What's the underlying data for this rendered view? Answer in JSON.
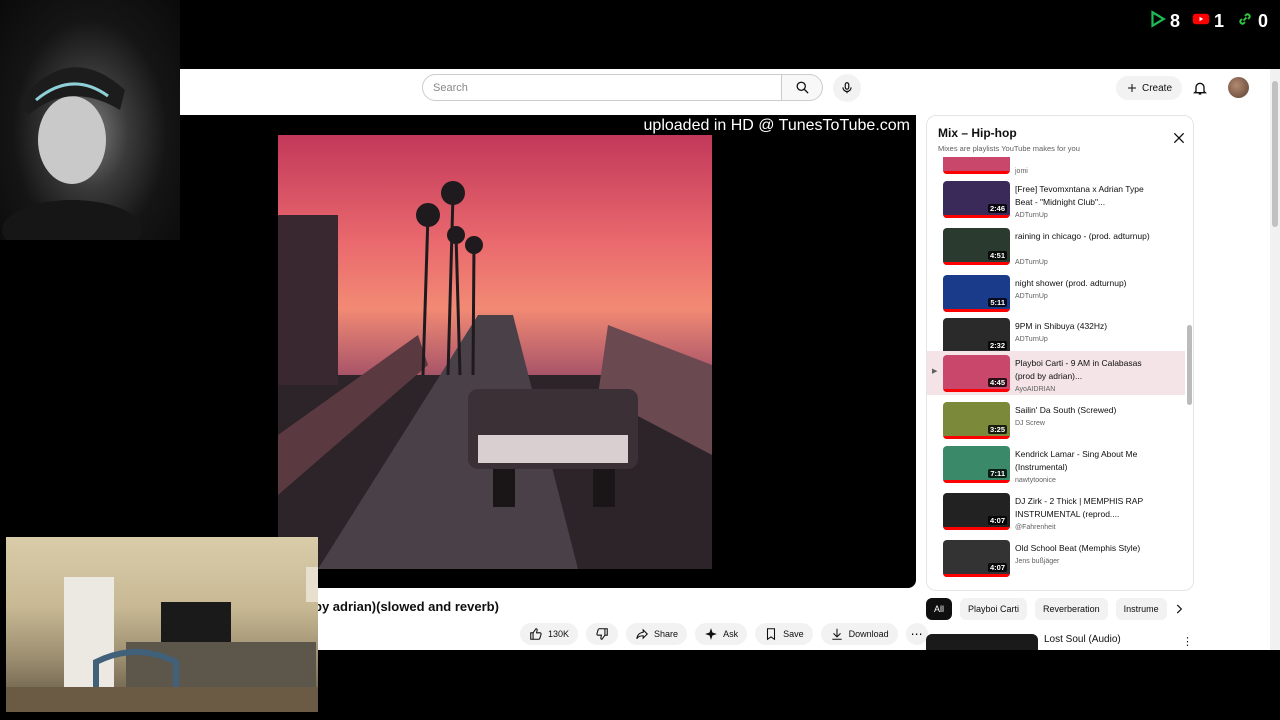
{
  "overlay": {
    "counters": [
      {
        "icon": "play-triangle-icon",
        "color": "#1db954",
        "value": "8"
      },
      {
        "icon": "youtube-icon",
        "color": "#ff0000",
        "value": "1"
      },
      {
        "icon": "link-icon",
        "color": "#2ecc40",
        "value": "0"
      }
    ]
  },
  "header": {
    "search_placeholder": "Search",
    "create_label": "Create"
  },
  "player": {
    "watermark": "uploaded in HD @ TunesToTube.com",
    "title_visible": "by adrian)(slowed and reverb)"
  },
  "actions": {
    "like_count": "130K",
    "share_label": "Share",
    "ask_label": "Ask",
    "save_label": "Save",
    "download_label": "Download"
  },
  "mix": {
    "title": "Mix – Hip-hop",
    "subtitle": "Mixes are playlists YouTube makes for you",
    "partial_top_channel": "jomi",
    "items": [
      {
        "title": "[Free] Tevomxntana x Adrian Type Beat - \"Midnight Club\"...",
        "channel": "ADTurnUp",
        "duration": "2:46",
        "thumb": "#3a2a5a"
      },
      {
        "title": "raining in chicago - (prod. adturnup)",
        "channel": "ADTurnUp",
        "duration": "4:51",
        "thumb": "#2a3a2e"
      },
      {
        "title": "night shower (prod. adturnup)",
        "channel": "ADTurnUp",
        "duration": "5:11",
        "thumb": "#1a3a8a"
      },
      {
        "title": "9PM in Shibuya (432Hz)",
        "channel": "ADTurnUp",
        "duration": "2:32",
        "thumb": "#2a2a2a"
      },
      {
        "title": "Playboi Carti - 9 AM in Calabasas (prod by adrian)...",
        "channel": "AyoAIDRIAN",
        "duration": "4:45",
        "thumb": "#c8476a",
        "active": true
      },
      {
        "title": "Sailin' Da South (Screwed)",
        "channel": "DJ Screw",
        "duration": "3:25",
        "thumb": "#7a8a3a"
      },
      {
        "title": "Kendrick Lamar - Sing About Me (Instrumental)",
        "channel": "nawtytoonice",
        "duration": "7:11",
        "thumb": "#3a8a6a"
      },
      {
        "title": "DJ Zirk - 2 Thick | MEMPHIS RAP INSTRUMENTAL (reprod....",
        "channel": "@Fahrenheit",
        "duration": "4:07",
        "thumb": "#222222"
      },
      {
        "title": "Old School Beat (Memphis Style)",
        "channel": "Jens bußjäger",
        "duration": "4:07",
        "thumb": "#333333"
      }
    ]
  },
  "chips": [
    "All",
    "Playboi Carti",
    "Reverberation",
    "Instrume"
  ],
  "recommendation": {
    "title": "Lost Soul (Audio)"
  }
}
